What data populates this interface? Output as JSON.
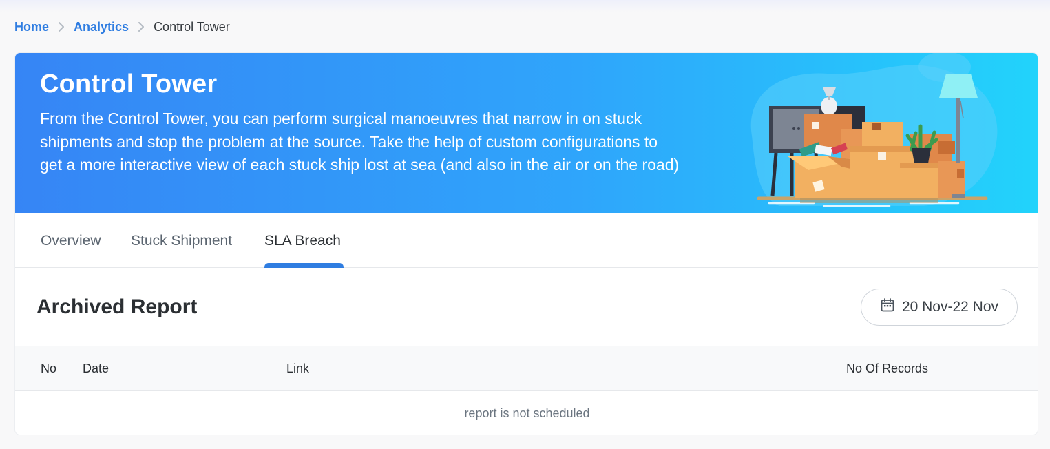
{
  "breadcrumb": {
    "items": [
      {
        "label": "Home",
        "link": true
      },
      {
        "label": "Analytics",
        "link": true
      },
      {
        "label": "Control Tower",
        "link": false
      }
    ]
  },
  "banner": {
    "title": "Control Tower",
    "description": "From the Control Tower, you can perform surgical manoeuvres that narrow in on stuck shipments and stop the problem at the source. Take the help of custom configurations to get a more interactive view of each stuck ship lost at sea (and also in the air or on the road)",
    "illustration": "moving-boxes-illustration"
  },
  "tabs": [
    {
      "label": "Overview",
      "active": false
    },
    {
      "label": "Stuck Shipment",
      "active": false
    },
    {
      "label": "SLA Breach",
      "active": true
    }
  ],
  "report": {
    "title": "Archived Report",
    "date_range": "20 Nov-22 Nov",
    "date_icon": "calendar-icon"
  },
  "table": {
    "columns": [
      "No",
      "Date",
      "Link",
      "No Of Records"
    ],
    "empty_message": "report is not scheduled"
  },
  "colors": {
    "accent": "#2f7de1",
    "banner_start": "#3685f5",
    "banner_end": "#22d3fb"
  }
}
